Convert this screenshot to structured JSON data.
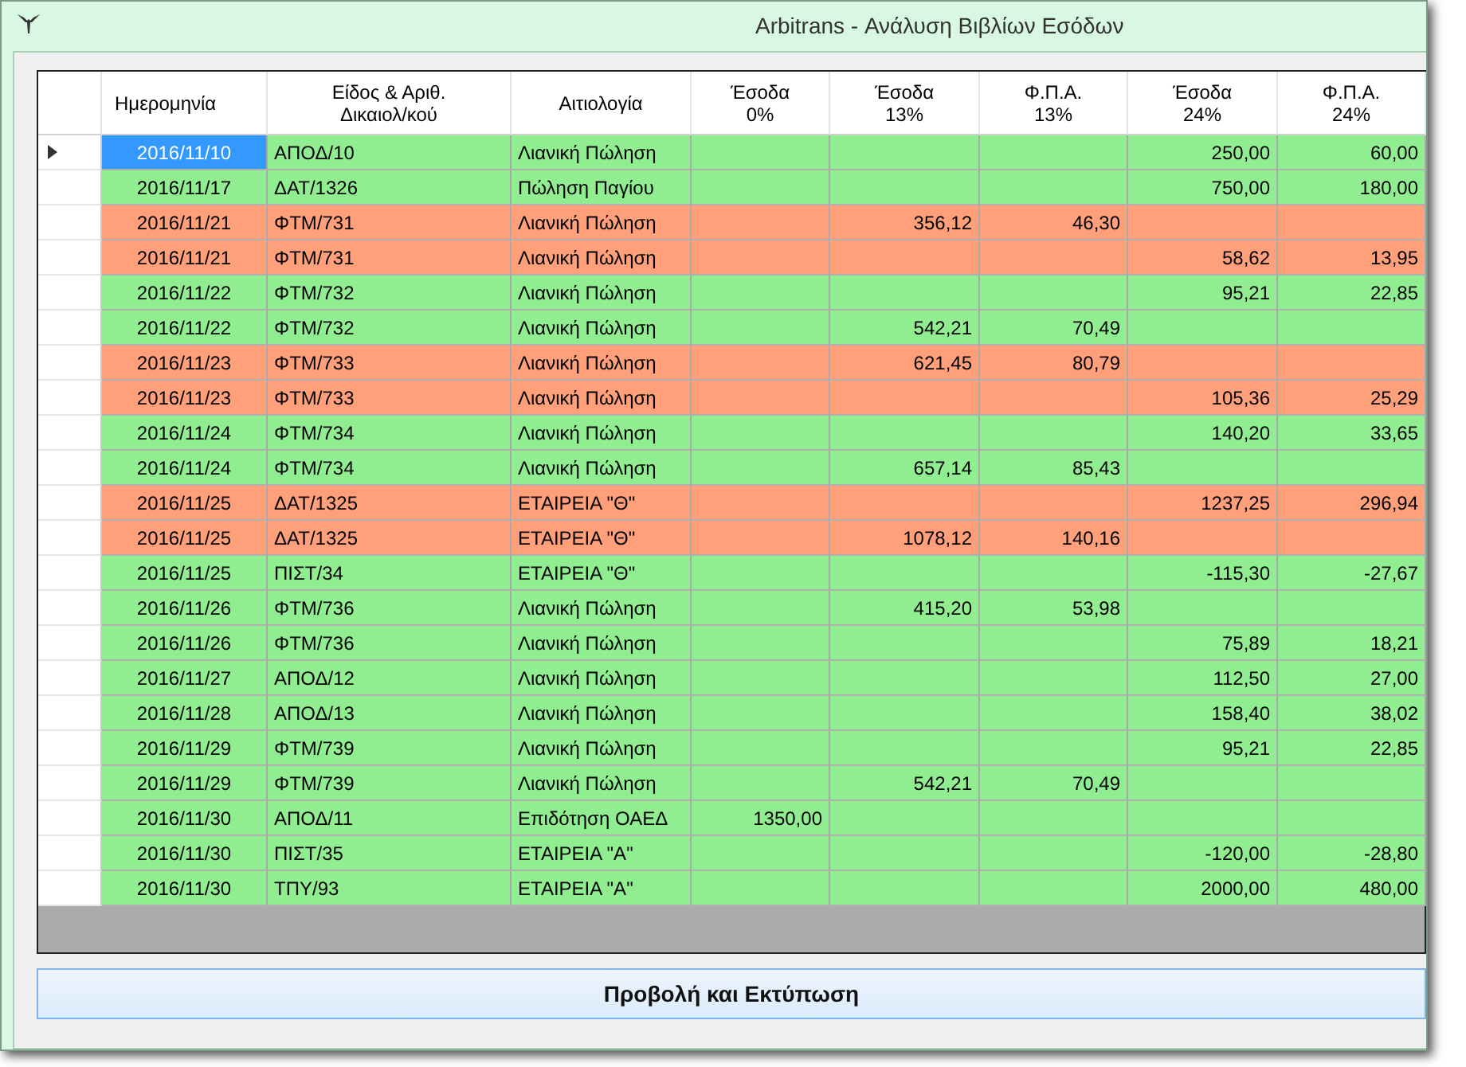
{
  "window": {
    "title": "Arbitrans - Ανάλυση Βιβλίων Εσόδων"
  },
  "table": {
    "columns": [
      "Ημερομηνία",
      "Είδος & Αριθ.\nΔικαιολ/κού",
      "Αιτιολογία",
      "Έσοδα\n0%",
      "Έσοδα\n13%",
      "Φ.Π.Α.\n13%",
      "Έσοδα\n24%",
      "Φ.Π.Α.\n24%"
    ],
    "rows": [
      {
        "selected": true,
        "color": "#90ee90",
        "date": "2016/11/10",
        "doc": "ΑΠΟΔ/10",
        "reason": "Λιανική Πώληση",
        "income_24": "250,00",
        "vat_24": "60,00"
      },
      {
        "selected": false,
        "color": "#90ee90",
        "date": "2016/11/17",
        "doc": "ΔΑΤ/1326",
        "reason": "Πώληση Παγίου",
        "income_24": "750,00",
        "vat_24": "180,00"
      },
      {
        "selected": false,
        "color": "#ffa07a",
        "date": "2016/11/21",
        "doc": "ΦΤΜ/731",
        "reason": "Λιανική Πώληση",
        "income_13": "356,12",
        "vat_13": "46,30"
      },
      {
        "selected": false,
        "color": "#ffa07a",
        "date": "2016/11/21",
        "doc": "ΦΤΜ/731",
        "reason": "Λιανική Πώληση",
        "income_24": "58,62",
        "vat_24": "13,95"
      },
      {
        "selected": false,
        "color": "#90ee90",
        "date": "2016/11/22",
        "doc": "ΦΤΜ/732",
        "reason": "Λιανική Πώληση",
        "income_24": "95,21",
        "vat_24": "22,85"
      },
      {
        "selected": false,
        "color": "#90ee90",
        "date": "2016/11/22",
        "doc": "ΦΤΜ/732",
        "reason": "Λιανική Πώληση",
        "income_13": "542,21",
        "vat_13": "70,49"
      },
      {
        "selected": false,
        "color": "#ffa07a",
        "date": "2016/11/23",
        "doc": "ΦΤΜ/733",
        "reason": "Λιανική Πώληση",
        "income_13": "621,45",
        "vat_13": "80,79"
      },
      {
        "selected": false,
        "color": "#ffa07a",
        "date": "2016/11/23",
        "doc": "ΦΤΜ/733",
        "reason": "Λιανική Πώληση",
        "income_24": "105,36",
        "vat_24": "25,29"
      },
      {
        "selected": false,
        "color": "#90ee90",
        "date": "2016/11/24",
        "doc": "ΦΤΜ/734",
        "reason": "Λιανική Πώληση",
        "income_24": "140,20",
        "vat_24": "33,65"
      },
      {
        "selected": false,
        "color": "#90ee90",
        "date": "2016/11/24",
        "doc": "ΦΤΜ/734",
        "reason": "Λιανική Πώληση",
        "income_13": "657,14",
        "vat_13": "85,43"
      },
      {
        "selected": false,
        "color": "#ffa07a",
        "date": "2016/11/25",
        "doc": "ΔΑΤ/1325",
        "reason": "ΕΤΑΙΡΕΙΑ \"Θ\"",
        "income_24": "1237,25",
        "vat_24": "296,94"
      },
      {
        "selected": false,
        "color": "#ffa07a",
        "date": "2016/11/25",
        "doc": "ΔΑΤ/1325",
        "reason": "ΕΤΑΙΡΕΙΑ \"Θ\"",
        "income_13": "1078,12",
        "vat_13": "140,16"
      },
      {
        "selected": false,
        "color": "#90ee90",
        "date": "2016/11/25",
        "doc": "ΠΙΣΤ/34",
        "reason": "ΕΤΑΙΡΕΙΑ \"Θ\"",
        "income_24": "-115,30",
        "vat_24": "-27,67"
      },
      {
        "selected": false,
        "color": "#90ee90",
        "date": "2016/11/26",
        "doc": "ΦΤΜ/736",
        "reason": "Λιανική Πώληση",
        "income_13": "415,20",
        "vat_13": "53,98"
      },
      {
        "selected": false,
        "color": "#90ee90",
        "date": "2016/11/26",
        "doc": "ΦΤΜ/736",
        "reason": "Λιανική Πώληση",
        "income_24": "75,89",
        "vat_24": "18,21"
      },
      {
        "selected": false,
        "color": "#90ee90",
        "date": "2016/11/27",
        "doc": "ΑΠΟΔ/12",
        "reason": "Λιανική Πώληση",
        "income_24": "112,50",
        "vat_24": "27,00"
      },
      {
        "selected": false,
        "color": "#90ee90",
        "date": "2016/11/28",
        "doc": "ΑΠΟΔ/13",
        "reason": "Λιανική Πώληση",
        "income_24": "158,40",
        "vat_24": "38,02"
      },
      {
        "selected": false,
        "color": "#90ee90",
        "date": "2016/11/29",
        "doc": "ΦΤΜ/739",
        "reason": "Λιανική Πώληση",
        "income_24": "95,21",
        "vat_24": "22,85"
      },
      {
        "selected": false,
        "color": "#90ee90",
        "date": "2016/11/29",
        "doc": "ΦΤΜ/739",
        "reason": "Λιανική Πώληση",
        "income_13": "542,21",
        "vat_13": "70,49"
      },
      {
        "selected": false,
        "color": "#90ee90",
        "date": "2016/11/30",
        "doc": "ΑΠΟΔ/11",
        "reason": "Επιδότηση ΟΑΕΔ",
        "income_0": "1350,00"
      },
      {
        "selected": false,
        "color": "#90ee90",
        "date": "2016/11/30",
        "doc": "ΠΙΣΤ/35",
        "reason": "ΕΤΑΙΡΕΙΑ \"Α\"",
        "income_24": "-120,00",
        "vat_24": "-28,80"
      },
      {
        "selected": false,
        "color": "#90ee90",
        "date": "2016/11/30",
        "doc": "ΤΠΥ/93",
        "reason": "ΕΤΑΙΡΕΙΑ \"Α\"",
        "income_24": "2000,00",
        "vat_24": "480,00"
      }
    ]
  },
  "print_button": {
    "label": "Προβολή και Εκτύπωση"
  }
}
